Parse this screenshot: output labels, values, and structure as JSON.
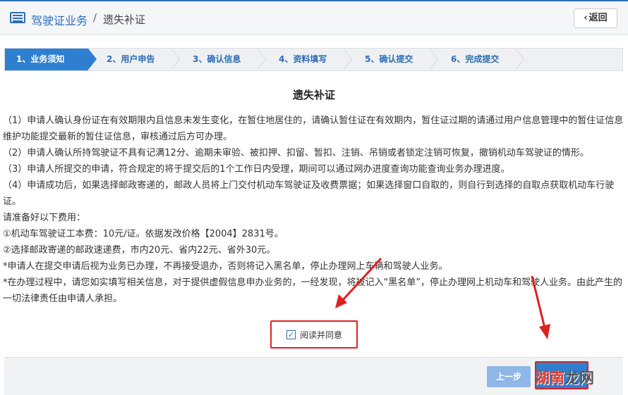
{
  "header": {
    "title": "驾驶证业务",
    "separator": "/",
    "subtitle": "遗失补证",
    "back_label": "返回",
    "icon": "list-icon",
    "back_icon": "chevron-left-icon"
  },
  "steps": [
    {
      "label": "1、业务须知",
      "active": true
    },
    {
      "label": "2、用户申告",
      "active": false
    },
    {
      "label": "3、确认信息",
      "active": false
    },
    {
      "label": "4、资料填写",
      "active": false
    },
    {
      "label": "5、确认提交",
      "active": false
    },
    {
      "label": "6、完成提交",
      "active": false
    }
  ],
  "notice": {
    "title": "遗失补证",
    "paragraphs": [
      "（1）申请人确认身份证在有效期限内且信息未发生变化，在暂住地居住的，请确认暂住证在有效期内，暂住证过期的请通过用户信息管理中的暂住证信息维护功能提交最新的暂住证信息，审核通过后方可办理。",
      "（2）申请人确认所持驾驶证不具有记满12分、逾期未审验、被扣押、扣留、暂扣、注销、吊销或者锁定注销可恢复，撤销机动车驾驶证的情形。",
      "（3）申请人所提交的申请，符合规定的将于提交后的1个工作日内受理，期间可以通过网办进度查询功能查询业务办理进度。",
      "（4）申请成功后，如果选择邮政寄递的，邮政人员将上门交付机动车驾驶证及收费票据；如果选择窗口自取的，则自行到选择的自取点获取机动车行驶证。",
      "请准备好以下费用：",
      "①机动车驾驶证工本费：10元/证。依据发改价格【2004】2831号。",
      "②选择邮政寄递的邮政速递费，市内20元、省内22元、省外30元。",
      "*申请人在提交申请后视为业务已办理，不再接受退办，否则将记入黑名单，停止办理网上车辆和驾驶人业务。",
      "*在办理过程中，请您如实填写相关信息，对于提供虚假信息申办业务的，一经发现，将被记入“黑名单”，停止办理网上机动车和驾驶人业务。由此产生的一切法律责任由申请人承担。"
    ]
  },
  "agree": {
    "label": "阅读并同意",
    "checked": true
  },
  "footer": {
    "prev_label": "上一步"
  },
  "watermark": {
    "part1": "湖南",
    "part2": "龙网"
  },
  "colors": {
    "accent": "#2f7fd1",
    "brand": "#2f6db5",
    "highlight": "#e02020"
  }
}
